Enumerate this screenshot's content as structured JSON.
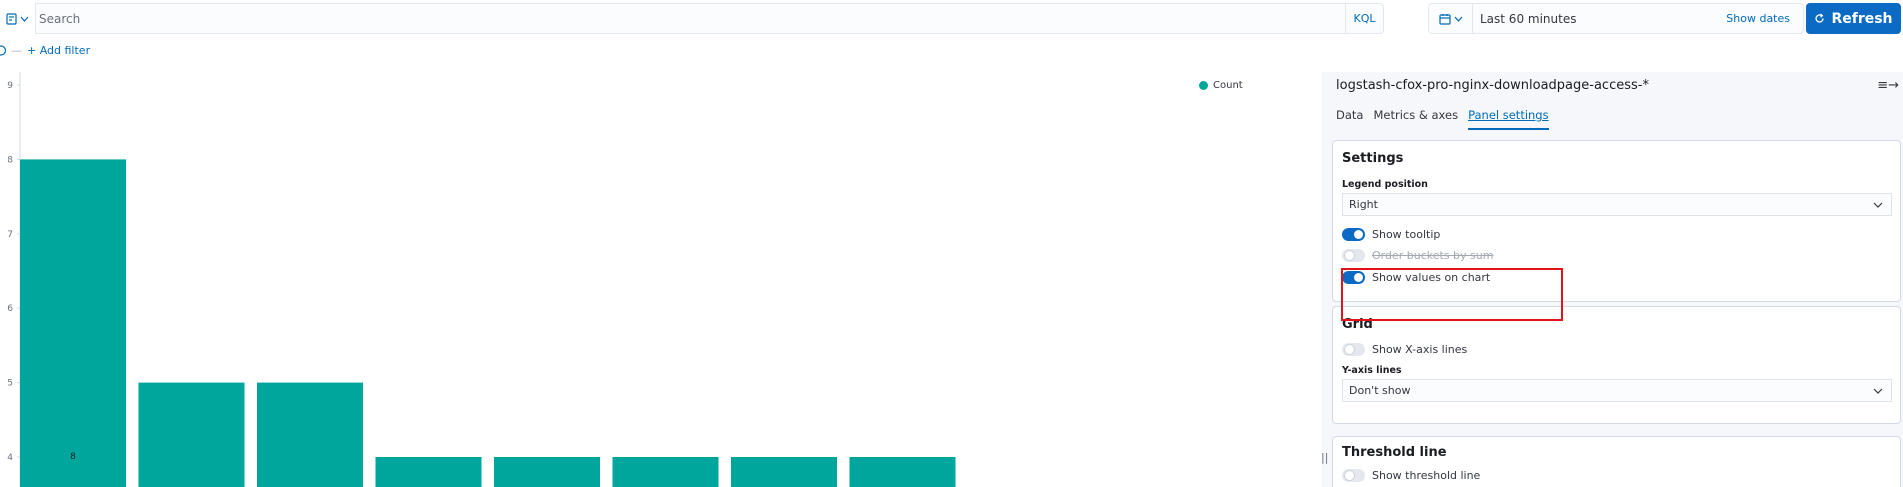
{
  "query_bar": {
    "search_placeholder": "Search",
    "language": "KQL",
    "time_range": "Last 60 minutes",
    "show_dates": "Show dates",
    "refresh_label": "Refresh"
  },
  "filter_bar": {
    "add_filter": "+ Add filter"
  },
  "chart_data": {
    "type": "bar",
    "categories": [
      "",
      "",
      "",
      "",
      "",
      "",
      "",
      ""
    ],
    "values": [
      8,
      5,
      5,
      4,
      4,
      4,
      4,
      4
    ],
    "series": [
      {
        "name": "Count",
        "values": [
          8,
          5,
          5,
          4,
          4,
          4,
          4,
          4
        ]
      }
    ],
    "y_ticks": [
      "9",
      "8",
      "7",
      "6",
      "5",
      "4"
    ],
    "ylim": [
      3.6,
      9
    ],
    "value_label": "8",
    "legend": [
      "Count"
    ],
    "legend_position": "top-right",
    "bar_color": "#00a69b",
    "title": "",
    "xlabel": "",
    "ylabel": ""
  },
  "panel": {
    "index_pattern": "logstash-cfox-pro-nginx-downloadpage-access-*",
    "tabs": [
      {
        "label": "Data",
        "active": false
      },
      {
        "label": "Metrics & axes",
        "active": false
      },
      {
        "label": "Panel settings",
        "active": true
      }
    ],
    "settings": {
      "title": "Settings",
      "legend_position_label": "Legend position",
      "legend_position_value": "Right",
      "show_tooltip": {
        "label": "Show tooltip",
        "on": true
      },
      "order_buckets": {
        "label": "Order buckets by sum",
        "on": false
      },
      "show_values": {
        "label": "Show values on chart",
        "on": true
      }
    },
    "grid": {
      "title": "Grid",
      "show_x_lines": {
        "label": "Show X-axis lines",
        "on": false
      },
      "y_lines_label": "Y-axis lines",
      "y_lines_value": "Don't show"
    },
    "threshold": {
      "title": "Threshold line",
      "show_threshold": {
        "label": "Show threshold line",
        "on": false
      }
    }
  },
  "colors": {
    "accent": "#0b6bc4",
    "bar": "#00a69b",
    "highlight_box": "#e3131b"
  }
}
